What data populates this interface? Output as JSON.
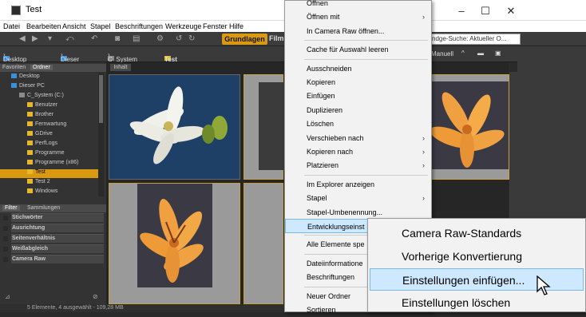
{
  "window": {
    "title": "Test",
    "minimize": "–",
    "maximize": "☐",
    "close": "✕"
  },
  "menubar": [
    "Datei",
    "Bearbeiten",
    "Ansicht",
    "Stapel",
    "Beschriftungen",
    "Werkzeuge",
    "Fenster",
    "Hilfe"
  ],
  "toolbar": {
    "workspace_active": "Grundlagen",
    "workspace_next": "Film",
    "search_placeholder": "ndge-Suche: Aktueller O..."
  },
  "pathbar": {
    "items": [
      "Desktop",
      "Dieser PC",
      "C_System (C:)",
      "Test"
    ],
    "sort_label": "Manuell"
  },
  "leftpanel": {
    "tabs": [
      "Favoriten",
      "Ordner"
    ],
    "tree": [
      {
        "label": "Desktop",
        "type": "blue"
      },
      {
        "label": "Dieser PC",
        "type": "blue"
      },
      {
        "label": "C_System (C:)",
        "type": "drive"
      },
      {
        "label": "Benutzer",
        "type": "folder"
      },
      {
        "label": "Brother",
        "type": "folder"
      },
      {
        "label": "Fernwartung",
        "type": "folder"
      },
      {
        "label": "GDrive",
        "type": "folder"
      },
      {
        "label": "PerfLogs",
        "type": "folder"
      },
      {
        "label": "Programme",
        "type": "folder"
      },
      {
        "label": "Programme (x86)",
        "type": "folder"
      },
      {
        "label": "Test",
        "type": "folder",
        "selected": true
      },
      {
        "label": "Test 2",
        "type": "folder"
      },
      {
        "label": "Windows",
        "type": "folder"
      }
    ],
    "filter_tabs": [
      "Filter",
      "Sammlungen"
    ],
    "filters": [
      "Stichwörter",
      "Ausrichtung",
      "Seitenverhältnis",
      "Weißabgleich",
      "Camera Raw"
    ]
  },
  "content": {
    "tab": "Inhalt"
  },
  "status": {
    "text": "5 Elemente, 4 ausgewählt - 109,28 MB"
  },
  "context_menu": {
    "items": [
      {
        "label": "Öffnen",
        "arrow": ""
      },
      {
        "label": "Öffnen mit",
        "arrow": "›"
      },
      {
        "label": "In Camera Raw öffnen...",
        "arrow": ""
      },
      {
        "sep": true
      },
      {
        "label": "Cache für Auswahl leeren",
        "arrow": ""
      },
      {
        "sep": true
      },
      {
        "label": "Ausschneiden",
        "arrow": ""
      },
      {
        "label": "Kopieren",
        "arrow": ""
      },
      {
        "label": "Einfügen",
        "arrow": ""
      },
      {
        "label": "Duplizieren",
        "arrow": ""
      },
      {
        "label": "Löschen",
        "arrow": ""
      },
      {
        "label": "Verschieben nach",
        "arrow": "›"
      },
      {
        "label": "Kopieren nach",
        "arrow": "›"
      },
      {
        "label": "Platzieren",
        "arrow": "›"
      },
      {
        "sep": true
      },
      {
        "label": "Im Explorer anzeigen",
        "arrow": ""
      },
      {
        "label": "Stapel",
        "arrow": "›"
      },
      {
        "label": "Stapel-Umbenennung...",
        "arrow": ""
      },
      {
        "label": "Entwicklungseinst",
        "arrow": "",
        "highlight": true
      },
      {
        "sep": true
      },
      {
        "label": "Alle Elemente spe",
        "arrow": ""
      },
      {
        "sep": true
      },
      {
        "label": "Dateiinformatione",
        "arrow": ""
      },
      {
        "label": "Beschriftungen",
        "arrow": ""
      },
      {
        "sep": true
      },
      {
        "label": "Neuer Ordner",
        "arrow": ""
      },
      {
        "label": "Sortieren",
        "arrow": ""
      }
    ]
  },
  "submenu": {
    "items": [
      {
        "label": "Camera Raw-Standards"
      },
      {
        "label": "Vorherige Konvertierung"
      },
      {
        "label": "Einstellungen einfügen...",
        "highlight": true
      },
      {
        "label": "Einstellungen löschen"
      }
    ]
  }
}
